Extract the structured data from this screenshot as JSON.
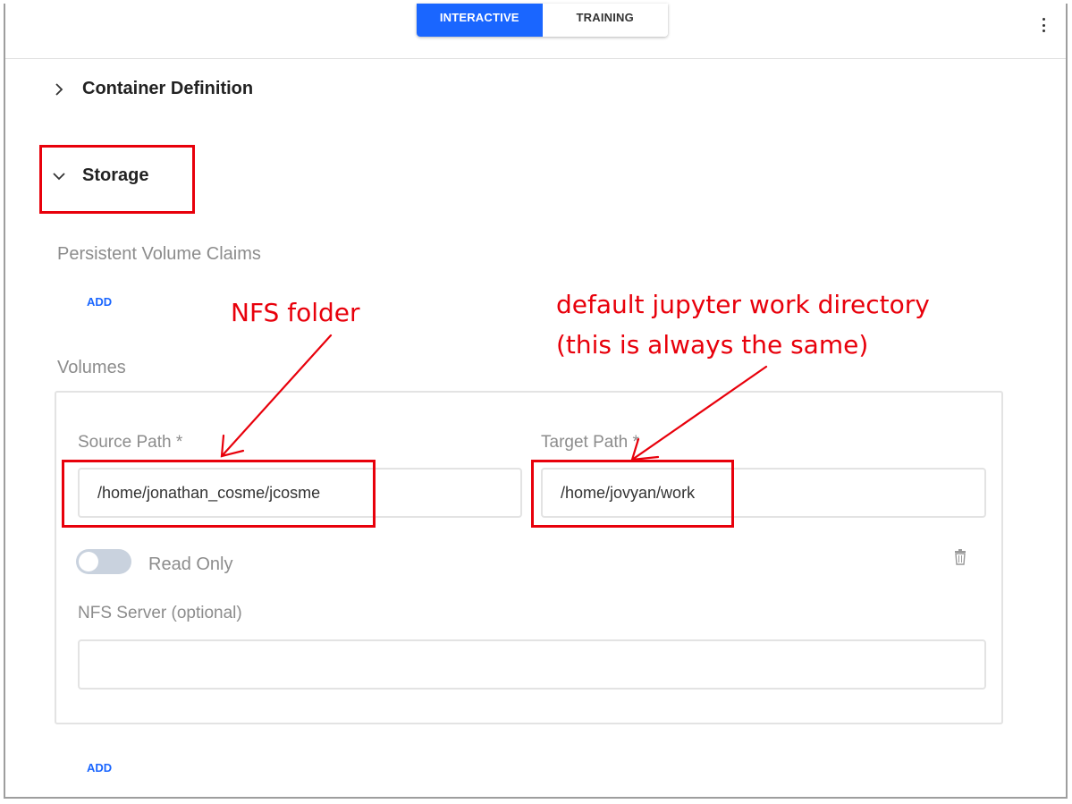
{
  "topbar": {
    "mode_tabs": [
      {
        "label": "INTERACTIVE",
        "active": true
      },
      {
        "label": "TRAINING",
        "active": false
      }
    ],
    "menu_icon": "more-vertical-icon"
  },
  "sections": {
    "container_definition": {
      "title": "Container Definition",
      "expanded": false,
      "icon": "chevron-right-icon"
    },
    "storage": {
      "title": "Storage",
      "expanded": true,
      "icon": "chevron-down-icon"
    }
  },
  "storage": {
    "pvc_label": "Persistent Volume Claims",
    "pvc_add_label": "ADD",
    "volumes_label": "Volumes",
    "volume": {
      "source_path_label": "Source Path *",
      "source_path_value": "/home/jonathan_cosme/jcosme",
      "target_path_label": "Target Path *",
      "target_path_value": "/home/jovyan/work",
      "read_only_label": "Read Only",
      "read_only": false,
      "nfs_server_label": "NFS Server (optional)",
      "nfs_server_value": "",
      "delete_icon": "trash-icon"
    },
    "volumes_add_label": "ADD"
  },
  "annotations": {
    "nfs_folder": "NFS folder",
    "jupyter_line1": "default jupyter work directory",
    "jupyter_line2": "(this is always the same)",
    "color": "#e8000b"
  },
  "colors": {
    "accent": "#1a66ff",
    "toggle_off": "#c9d2de",
    "muted_text": "#8c8c8c"
  }
}
